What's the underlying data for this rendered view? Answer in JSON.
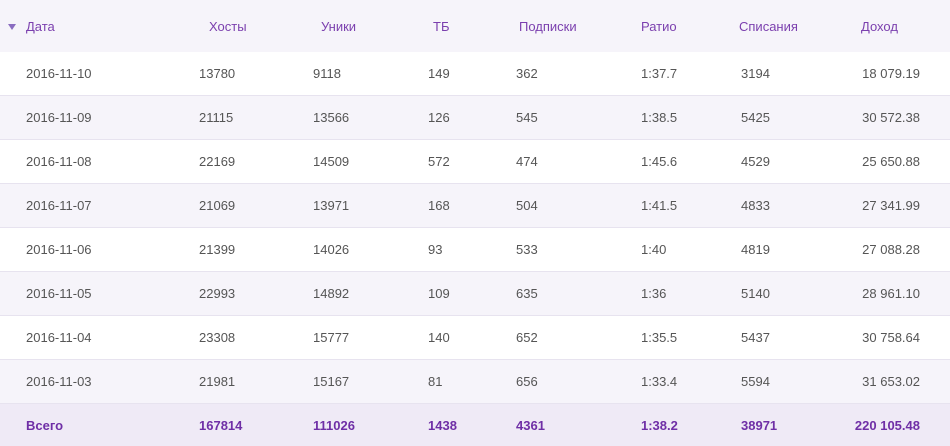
{
  "table": {
    "columns": [
      "Дата",
      "Хосты",
      "Уники",
      "ТБ",
      "Подписки",
      "Ратио",
      "Списания",
      "Доход"
    ],
    "sort_icon": "triangle-down-icon",
    "rows": [
      [
        "2016-11-10",
        "13780",
        "9118",
        "149",
        "362",
        "1:37.7",
        "3194",
        "18 079.19"
      ],
      [
        "2016-11-09",
        "21115",
        "13566",
        "126",
        "545",
        "1:38.5",
        "5425",
        "30 572.38"
      ],
      [
        "2016-11-08",
        "22169",
        "14509",
        "572",
        "474",
        "1:45.6",
        "4529",
        "25 650.88"
      ],
      [
        "2016-11-07",
        "21069",
        "13971",
        "168",
        "504",
        "1:41.5",
        "4833",
        "27 341.99"
      ],
      [
        "2016-11-06",
        "21399",
        "14026",
        "93",
        "533",
        "1:40",
        "4819",
        "27 088.28"
      ],
      [
        "2016-11-05",
        "22993",
        "14892",
        "109",
        "635",
        "1:36",
        "5140",
        "28 961.10"
      ],
      [
        "2016-11-04",
        "23308",
        "15777",
        "140",
        "652",
        "1:35.5",
        "5437",
        "30 758.64"
      ],
      [
        "2016-11-03",
        "21981",
        "15167",
        "81",
        "656",
        "1:33.4",
        "5594",
        "31 653.02"
      ]
    ],
    "total": [
      "Всего",
      "167814",
      "111026",
      "1438",
      "4361",
      "1:38.2",
      "38971",
      "220 105.48"
    ]
  },
  "colors": {
    "accent": "#7b3fae",
    "row_alt": "#f6f4fa",
    "total_bg": "#efeaf6",
    "text": "#555555"
  }
}
